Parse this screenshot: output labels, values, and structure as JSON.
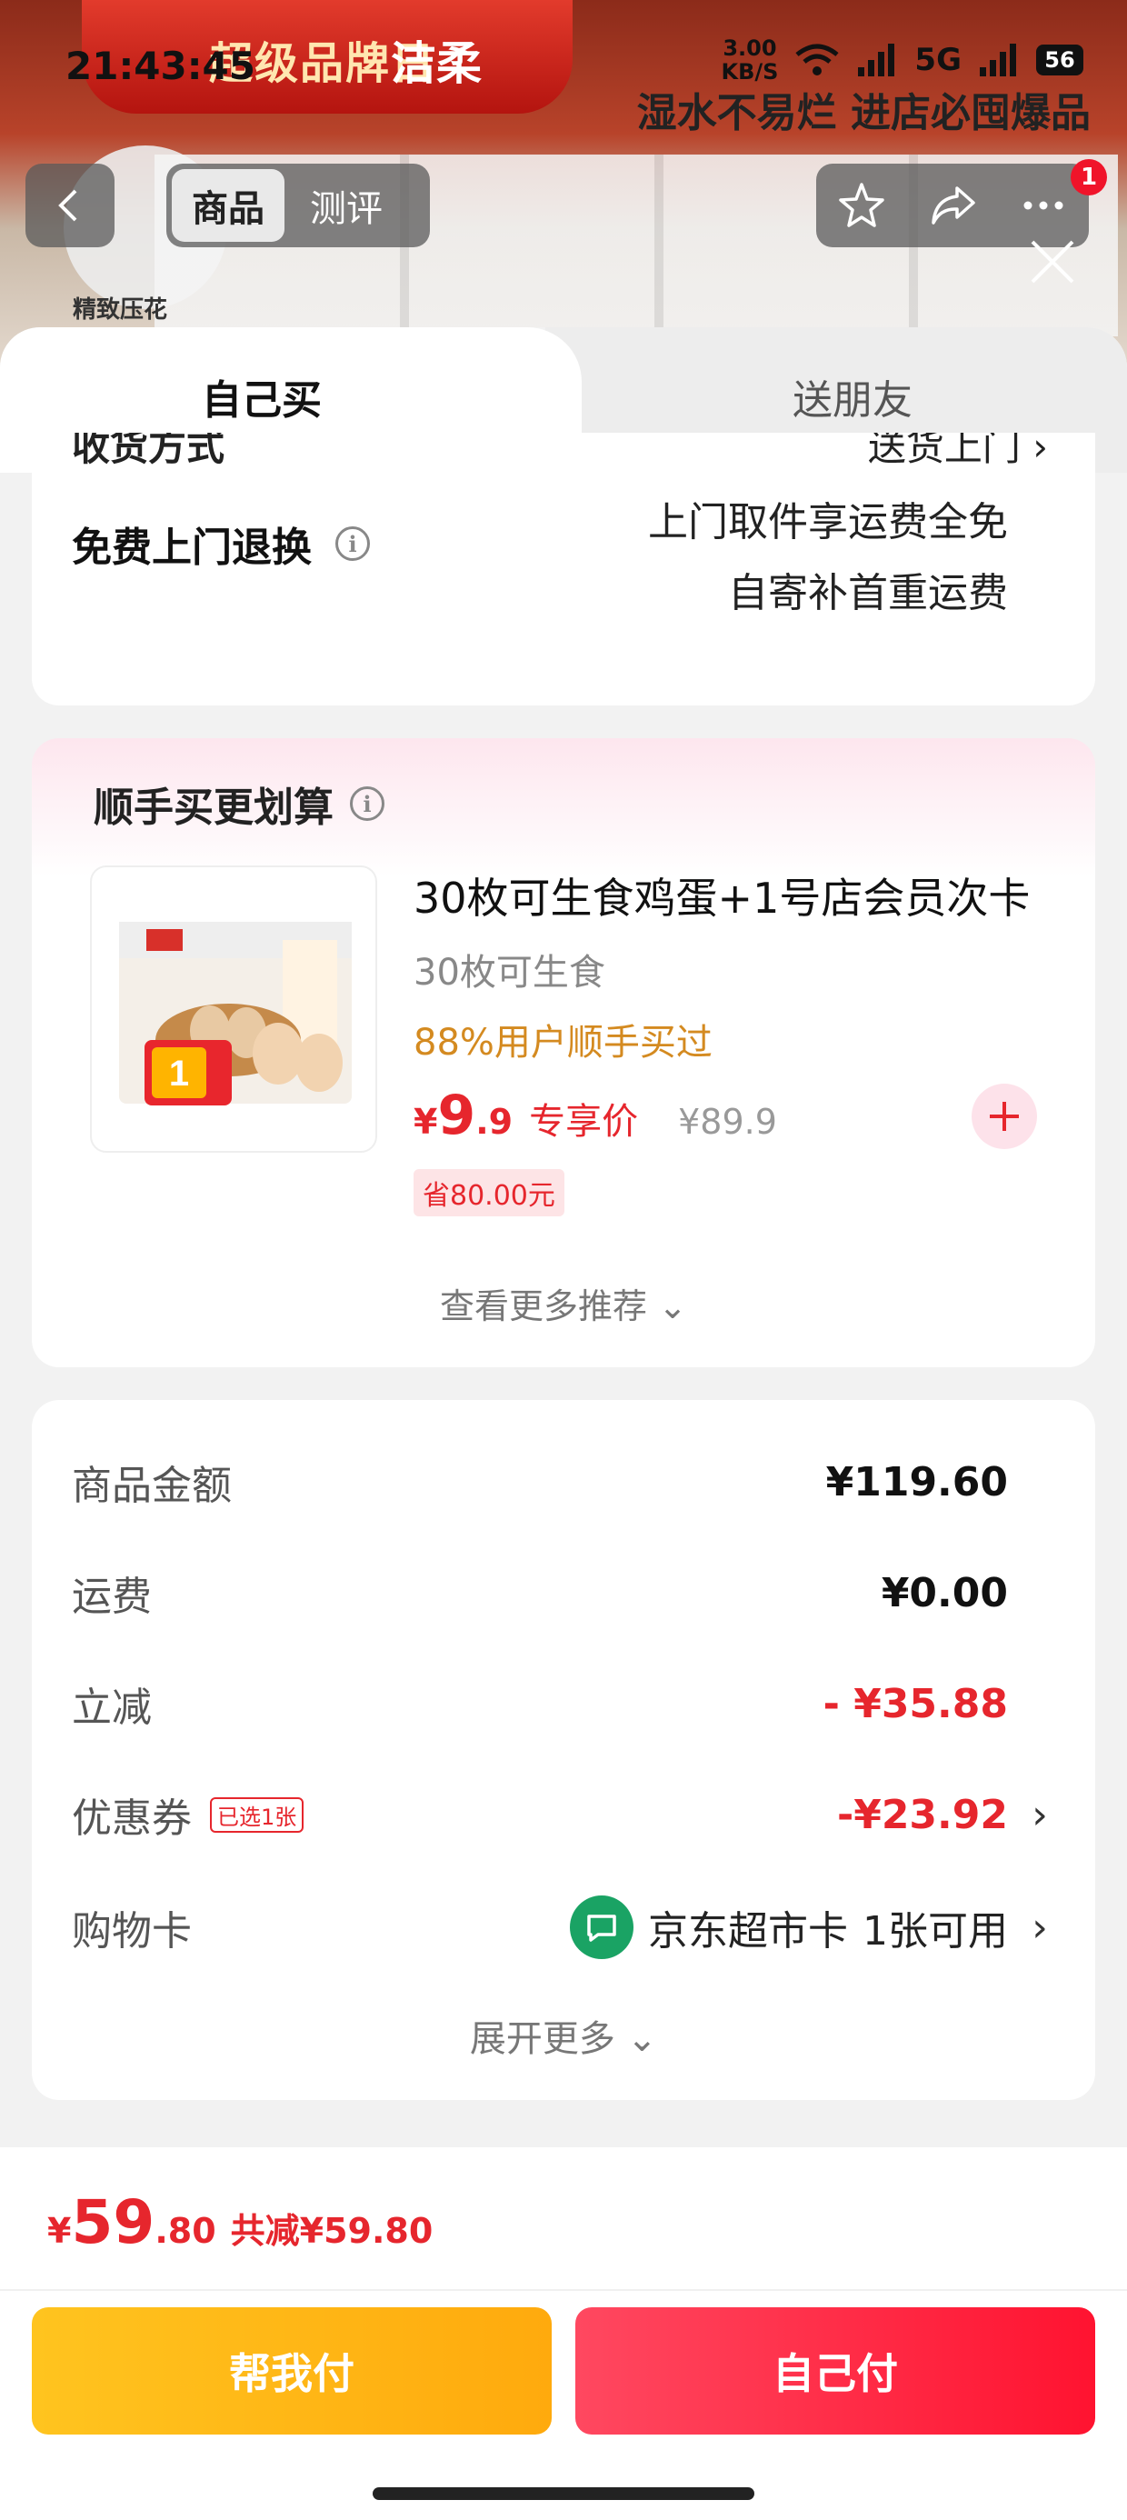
{
  "status_bar": {
    "time": "21:43:45",
    "speed_value": "3.00",
    "speed_unit": "KB/S",
    "network": "5G",
    "battery": "56"
  },
  "background": {
    "banner_text": "超级品牌日",
    "brand": "洁柔",
    "slogan": "湿水不易烂 进店必囤爆品",
    "tag": "精致压花"
  },
  "nav": {
    "tabs": [
      "商品",
      "测评"
    ],
    "cart_badge": "1"
  },
  "sheet": {
    "tabs": {
      "self": "自己买",
      "friend": "送朋友"
    },
    "shipping_row": {
      "label": "收货方式",
      "value": "送货上门 ›"
    },
    "return": {
      "label": "免费上门退换",
      "line1": "上门取件享运费全免",
      "line2": "自寄补首重运费"
    }
  },
  "recommend": {
    "title": "顺手买更划算",
    "product": {
      "name": "30枚可生食鸡蛋+1号店会员次卡",
      "sub": "30枚可生食",
      "social": "88%用户顺手买过",
      "price_currency": "¥",
      "price_int": "9",
      "price_dec": ".9",
      "price_label": "专享价",
      "orig_price": "¥89.9",
      "save": "省80.00元"
    },
    "more": "查看更多推荐 ⌄"
  },
  "summary": {
    "rows": [
      {
        "label": "商品金额",
        "value": "¥119.60"
      },
      {
        "label": "运费",
        "value": "¥0.00"
      },
      {
        "label": "立减",
        "value": "- ¥35.88"
      },
      {
        "label": "优惠券",
        "tag": "已选1张",
        "value": "-¥23.92"
      },
      {
        "label": "购物卡",
        "card_name": "京东超市卡",
        "card_avail": "1张可用"
      }
    ],
    "expand": "展开更多 ⌄",
    "arrow": "›"
  },
  "footer": {
    "total_currency": "¥",
    "total_int": "59",
    "total_dec": ".80",
    "total_save": "共减¥59.80",
    "btn_help": "帮我付",
    "btn_self": "自己付"
  },
  "colors": {
    "accent_red": "#e6262d",
    "help_yellow": "#ffb514",
    "pay_red": "#ff2a44",
    "card_green": "#1aa364"
  }
}
